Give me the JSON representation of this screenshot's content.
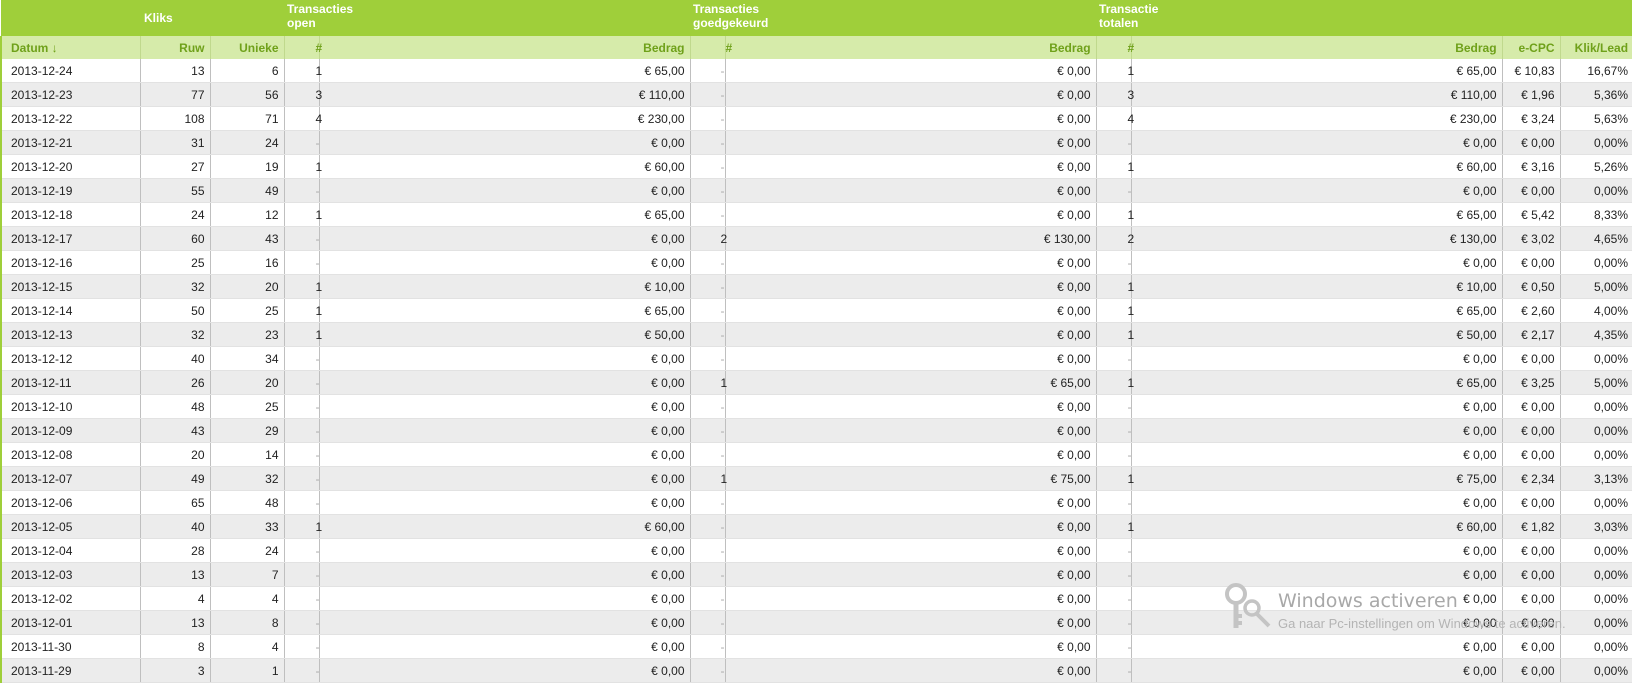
{
  "groups": {
    "kliks": "Kliks",
    "open_line1": "Transacties",
    "open_line2": "open",
    "approved_line1": "Transacties",
    "approved_line2": "goedgekeurd",
    "total_line1": "Transactie",
    "total_line2": "totalen"
  },
  "columns": [
    "Datum ↓",
    "Ruw",
    "Unieke",
    "#",
    "Bedrag",
    "#",
    "Bedrag",
    "#",
    "Bedrag",
    "e-CPC",
    "Klik/Lead"
  ],
  "rows": [
    [
      "2013-12-24",
      "13",
      "6",
      "1",
      "€ 65,00",
      "-",
      "€ 0,00",
      "1",
      "€ 65,00",
      "€ 10,83",
      "16,67%"
    ],
    [
      "2013-12-23",
      "77",
      "56",
      "3",
      "€ 110,00",
      "-",
      "€ 0,00",
      "3",
      "€ 110,00",
      "€ 1,96",
      "5,36%"
    ],
    [
      "2013-12-22",
      "108",
      "71",
      "4",
      "€ 230,00",
      "-",
      "€ 0,00",
      "4",
      "€ 230,00",
      "€ 3,24",
      "5,63%"
    ],
    [
      "2013-12-21",
      "31",
      "24",
      "-",
      "€ 0,00",
      "-",
      "€ 0,00",
      "-",
      "€ 0,00",
      "€ 0,00",
      "0,00%"
    ],
    [
      "2013-12-20",
      "27",
      "19",
      "1",
      "€ 60,00",
      "-",
      "€ 0,00",
      "1",
      "€ 60,00",
      "€ 3,16",
      "5,26%"
    ],
    [
      "2013-12-19",
      "55",
      "49",
      "-",
      "€ 0,00",
      "-",
      "€ 0,00",
      "-",
      "€ 0,00",
      "€ 0,00",
      "0,00%"
    ],
    [
      "2013-12-18",
      "24",
      "12",
      "1",
      "€ 65,00",
      "-",
      "€ 0,00",
      "1",
      "€ 65,00",
      "€ 5,42",
      "8,33%"
    ],
    [
      "2013-12-17",
      "60",
      "43",
      "-",
      "€ 0,00",
      "2",
      "€ 130,00",
      "2",
      "€ 130,00",
      "€ 3,02",
      "4,65%"
    ],
    [
      "2013-12-16",
      "25",
      "16",
      "-",
      "€ 0,00",
      "-",
      "€ 0,00",
      "-",
      "€ 0,00",
      "€ 0,00",
      "0,00%"
    ],
    [
      "2013-12-15",
      "32",
      "20",
      "1",
      "€ 10,00",
      "-",
      "€ 0,00",
      "1",
      "€ 10,00",
      "€ 0,50",
      "5,00%"
    ],
    [
      "2013-12-14",
      "50",
      "25",
      "1",
      "€ 65,00",
      "-",
      "€ 0,00",
      "1",
      "€ 65,00",
      "€ 2,60",
      "4,00%"
    ],
    [
      "2013-12-13",
      "32",
      "23",
      "1",
      "€ 50,00",
      "-",
      "€ 0,00",
      "1",
      "€ 50,00",
      "€ 2,17",
      "4,35%"
    ],
    [
      "2013-12-12",
      "40",
      "34",
      "-",
      "€ 0,00",
      "-",
      "€ 0,00",
      "-",
      "€ 0,00",
      "€ 0,00",
      "0,00%"
    ],
    [
      "2013-12-11",
      "26",
      "20",
      "-",
      "€ 0,00",
      "1",
      "€ 65,00",
      "1",
      "€ 65,00",
      "€ 3,25",
      "5,00%"
    ],
    [
      "2013-12-10",
      "48",
      "25",
      "-",
      "€ 0,00",
      "-",
      "€ 0,00",
      "-",
      "€ 0,00",
      "€ 0,00",
      "0,00%"
    ],
    [
      "2013-12-09",
      "43",
      "29",
      "-",
      "€ 0,00",
      "-",
      "€ 0,00",
      "-",
      "€ 0,00",
      "€ 0,00",
      "0,00%"
    ],
    [
      "2013-12-08",
      "20",
      "14",
      "-",
      "€ 0,00",
      "-",
      "€ 0,00",
      "-",
      "€ 0,00",
      "€ 0,00",
      "0,00%"
    ],
    [
      "2013-12-07",
      "49",
      "32",
      "-",
      "€ 0,00",
      "1",
      "€ 75,00",
      "1",
      "€ 75,00",
      "€ 2,34",
      "3,13%"
    ],
    [
      "2013-12-06",
      "65",
      "48",
      "-",
      "€ 0,00",
      "-",
      "€ 0,00",
      "-",
      "€ 0,00",
      "€ 0,00",
      "0,00%"
    ],
    [
      "2013-12-05",
      "40",
      "33",
      "1",
      "€ 60,00",
      "-",
      "€ 0,00",
      "1",
      "€ 60,00",
      "€ 1,82",
      "3,03%"
    ],
    [
      "2013-12-04",
      "28",
      "24",
      "-",
      "€ 0,00",
      "-",
      "€ 0,00",
      "-",
      "€ 0,00",
      "€ 0,00",
      "0,00%"
    ],
    [
      "2013-12-03",
      "13",
      "7",
      "-",
      "€ 0,00",
      "-",
      "€ 0,00",
      "-",
      "€ 0,00",
      "€ 0,00",
      "0,00%"
    ],
    [
      "2013-12-02",
      "4",
      "4",
      "-",
      "€ 0,00",
      "-",
      "€ 0,00",
      "-",
      "€ 0,00",
      "€ 0,00",
      "0,00%"
    ],
    [
      "2013-12-01",
      "13",
      "8",
      "-",
      "€ 0,00",
      "-",
      "€ 0,00",
      "-",
      "€ 0,00",
      "€ 0,00",
      "0,00%"
    ],
    [
      "2013-11-30",
      "8",
      "4",
      "-",
      "€ 0,00",
      "-",
      "€ 0,00",
      "-",
      "€ 0,00",
      "€ 0,00",
      "0,00%"
    ],
    [
      "2013-11-29",
      "3",
      "1",
      "-",
      "€ 0,00",
      "-",
      "€ 0,00",
      "-",
      "€ 0,00",
      "€ 0,00",
      "0,00%"
    ]
  ],
  "watermark": {
    "title": "Windows activeren",
    "subtitle": "Ga naar Pc-instellingen om Windows te activeren."
  }
}
